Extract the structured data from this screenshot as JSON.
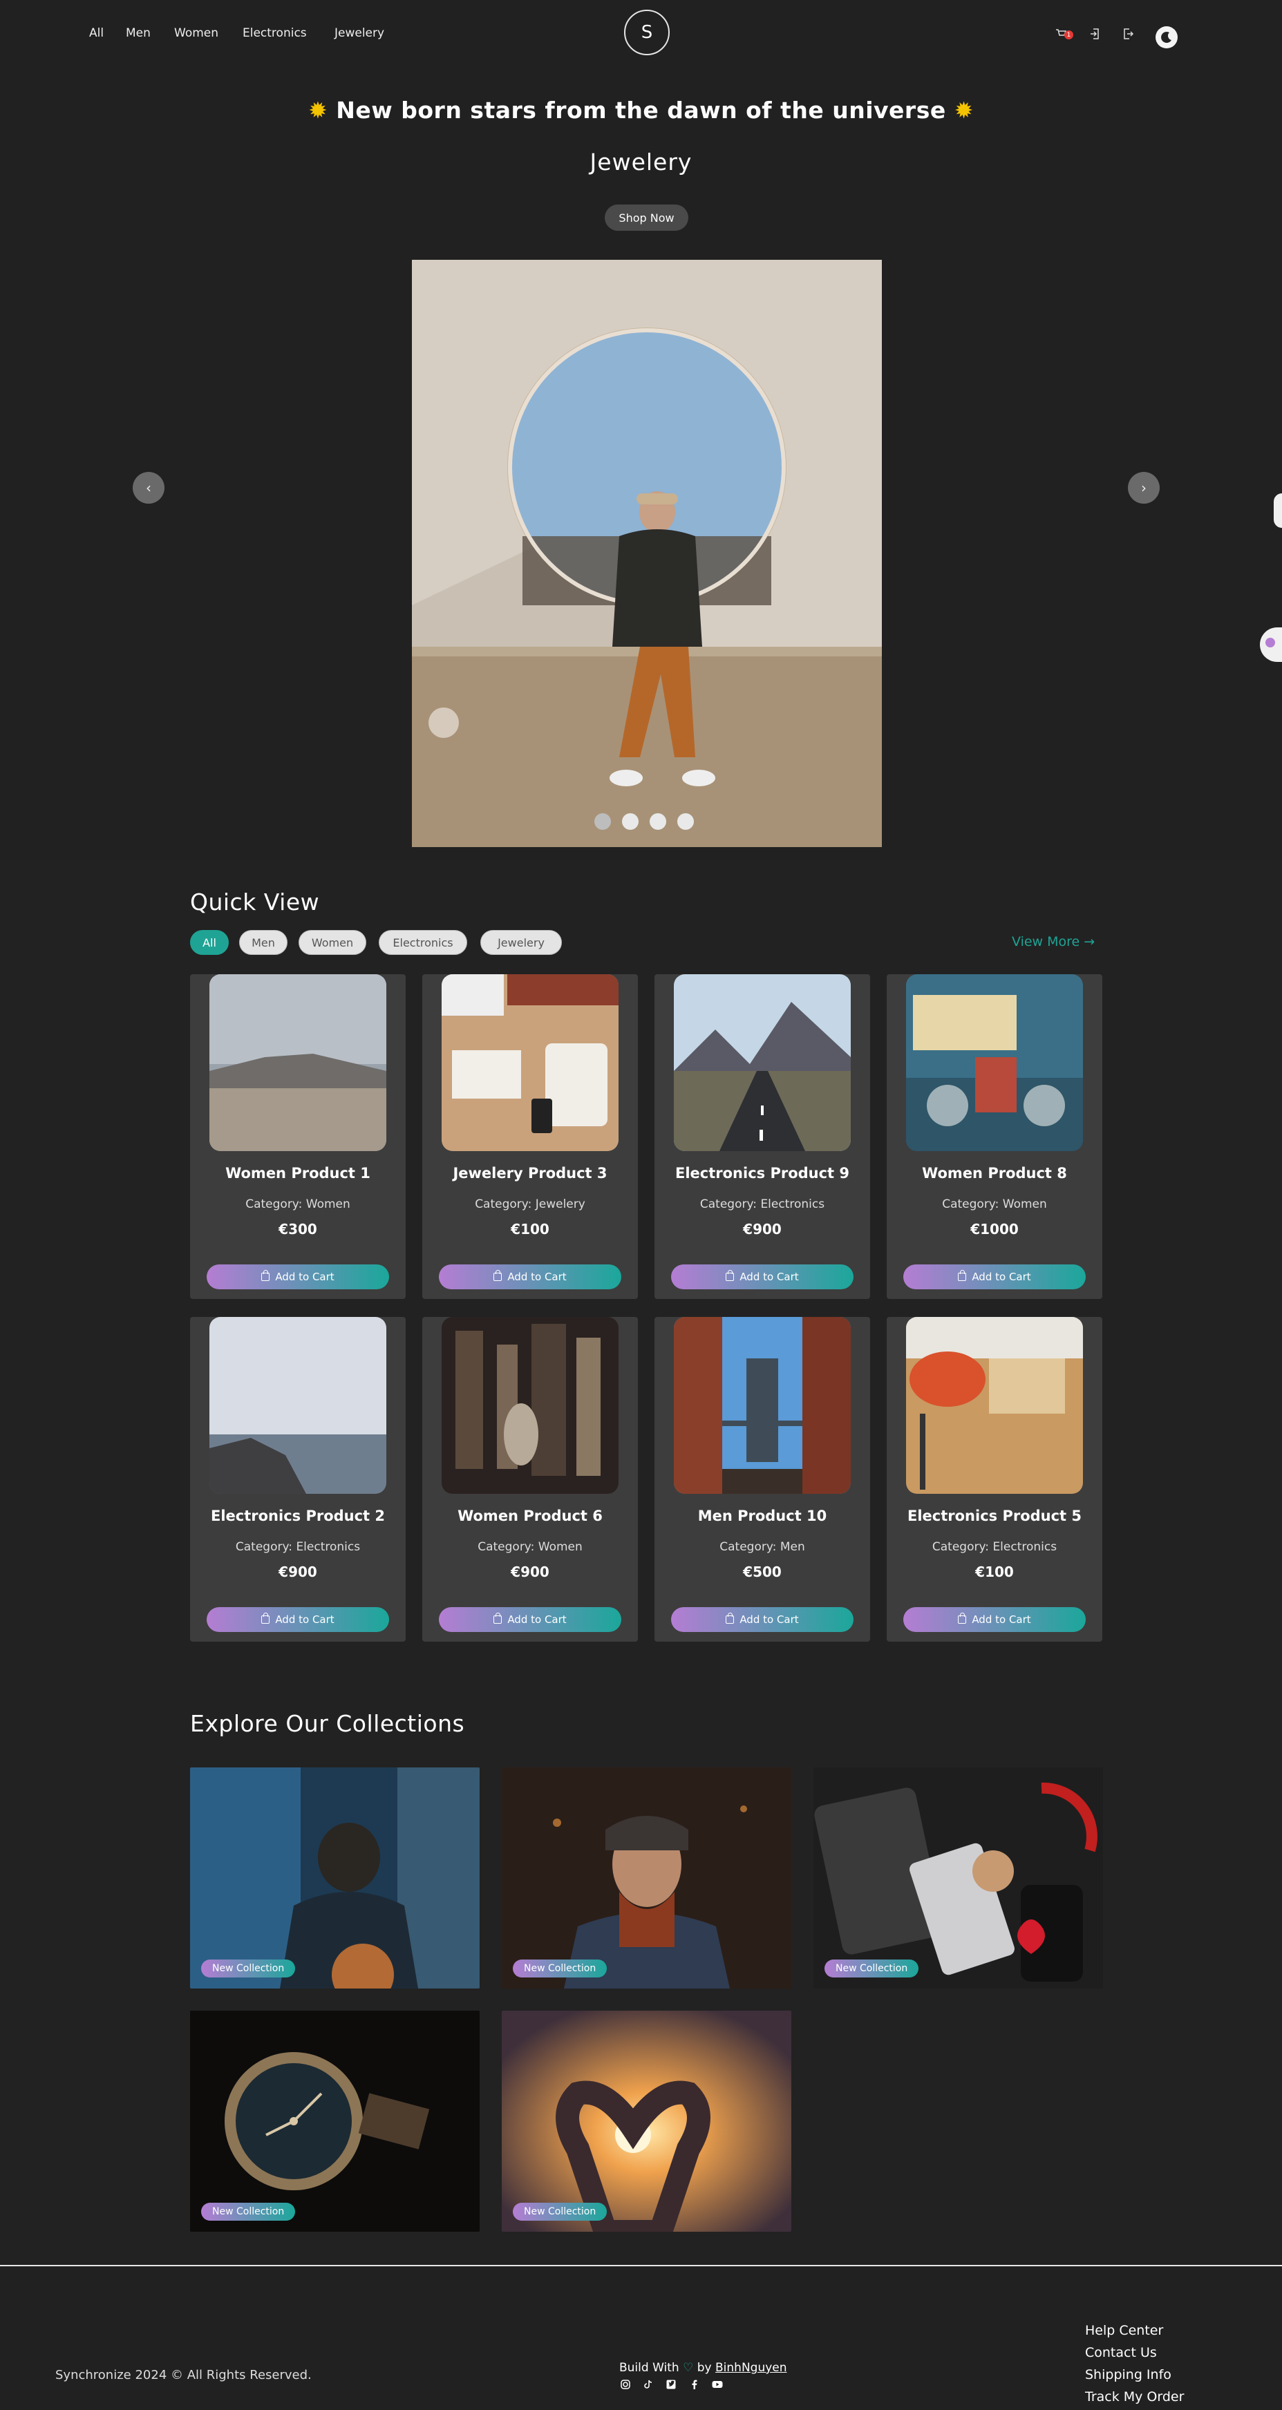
{
  "nav": {
    "links": [
      "All",
      "Men",
      "Women",
      "Electronics",
      "Jewelery"
    ],
    "logo": "S",
    "cart_count": "1"
  },
  "hero": {
    "title": "New born stars from the dawn of the universe",
    "subtitle": "Jewelery",
    "button": "Shop Now",
    "prev": "‹",
    "next": "›"
  },
  "quick_view": {
    "title": "Quick View",
    "filters": [
      "All",
      "Men",
      "Women",
      "Electronics",
      "Jewelery"
    ],
    "active_filter": "All",
    "view_more": "View More →",
    "add_to_cart": "Add to Cart",
    "products": [
      {
        "name": "Women Product 1",
        "category": "Category: Women",
        "price": "€300"
      },
      {
        "name": "Jewelery Product 3",
        "category": "Category: Jewelery",
        "price": "€100"
      },
      {
        "name": "Electronics Product 9",
        "category": "Category: Electronics",
        "price": "€900"
      },
      {
        "name": "Women Product 8",
        "category": "Category: Women",
        "price": "€1000"
      },
      {
        "name": "Electronics Product 2",
        "category": "Category: Electronics",
        "price": "€900"
      },
      {
        "name": "Women Product 6",
        "category": "Category: Women",
        "price": "€900"
      },
      {
        "name": "Men Product 10",
        "category": "Category: Men",
        "price": "€500"
      },
      {
        "name": "Electronics Product 5",
        "category": "Category: Electronics",
        "price": "€100"
      }
    ]
  },
  "collections": {
    "title": "Explore Our Collections",
    "badge": "New Collection"
  },
  "footer": {
    "copyright": "Synchronize 2024 © All Rights Reserved.",
    "build_prefix": "Build With",
    "build_by": "by",
    "author": "BinhNguyen",
    "links": [
      "Help Center",
      "Contact Us",
      "Shipping Info",
      "Track My Order"
    ]
  },
  "colors": {
    "background": "#212121",
    "card": "#3d3d3d",
    "accent": "#1fa394",
    "gradient_start": "#b57dd3"
  }
}
